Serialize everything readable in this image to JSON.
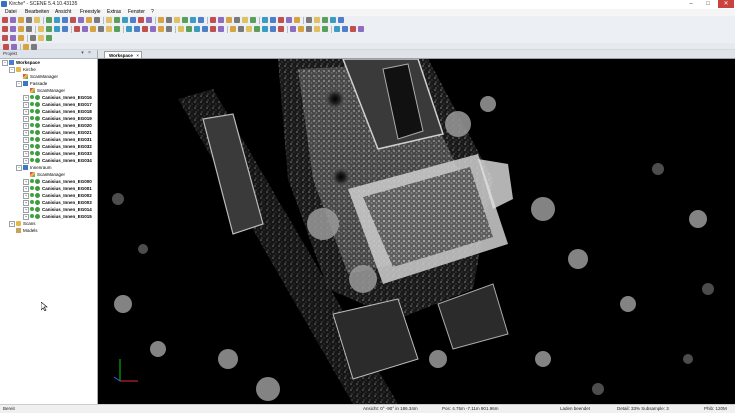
{
  "window": {
    "title": "Kirche* - SCENE 5.4.10.43135",
    "controls": [
      "–",
      "□",
      "✕"
    ]
  },
  "menu": [
    "Datei",
    "Bearbeiten",
    "Ansicht",
    "Freestyle",
    "Extras",
    "Fenster",
    "?"
  ],
  "panel": {
    "title": "Projekt",
    "tree": [
      {
        "label": "Workspace",
        "level": 0,
        "icon": "workspace-icon",
        "bold": true,
        "expander": "−"
      },
      {
        "label": "Kirche",
        "level": 1,
        "icon": "folder-icon",
        "bold": false,
        "expander": "−"
      },
      {
        "label": "ScanManager",
        "level": 2,
        "icon": "scanmanager-icon",
        "bold": false,
        "expander": ""
      },
      {
        "label": "Fassade",
        "level": 2,
        "icon": "scan-folder-icon",
        "bold": false,
        "expander": "−"
      },
      {
        "label": "ScanManager",
        "level": 3,
        "icon": "scanmanager-icon",
        "bold": false,
        "expander": ""
      },
      {
        "label": "Canisius_Innen_EG016",
        "level": 3,
        "icon": "scan-icon",
        "bold": true,
        "expander": "+"
      },
      {
        "label": "Canisius_Innen_EG017",
        "level": 3,
        "icon": "scan-icon",
        "bold": true,
        "expander": "+"
      },
      {
        "label": "Canisius_Innen_EG018",
        "level": 3,
        "icon": "scan-icon",
        "bold": true,
        "expander": "+"
      },
      {
        "label": "Canisius_Innen_EG019",
        "level": 3,
        "icon": "scan-icon",
        "bold": true,
        "expander": "+"
      },
      {
        "label": "Canisius_Innen_EG020",
        "level": 3,
        "icon": "scan-icon",
        "bold": true,
        "expander": "+"
      },
      {
        "label": "Canisius_Innen_EG021",
        "level": 3,
        "icon": "scan-icon",
        "bold": true,
        "expander": "+"
      },
      {
        "label": "Canisius_Innen_EG031",
        "level": 3,
        "icon": "scan-icon",
        "bold": true,
        "expander": "+"
      },
      {
        "label": "Canisius_Innen_EG032",
        "level": 3,
        "icon": "scan-icon",
        "bold": true,
        "expander": "+"
      },
      {
        "label": "Canisius_Innen_EG033",
        "level": 3,
        "icon": "scan-icon",
        "bold": true,
        "expander": "+"
      },
      {
        "label": "Canisius_Innen_EG034",
        "level": 3,
        "icon": "scan-icon",
        "bold": true,
        "expander": "+"
      },
      {
        "label": "Innenraum",
        "level": 2,
        "icon": "scan-folder-icon",
        "bold": false,
        "expander": "−"
      },
      {
        "label": "ScanManager",
        "level": 3,
        "icon": "scanmanager-icon",
        "bold": false,
        "expander": ""
      },
      {
        "label": "Canisius_Innen_EG000",
        "level": 3,
        "icon": "scan-icon",
        "bold": true,
        "expander": "+"
      },
      {
        "label": "Canisius_Innen_EG001",
        "level": 3,
        "icon": "scan-icon",
        "bold": true,
        "expander": "+"
      },
      {
        "label": "Canisius_Innen_EG002",
        "level": 3,
        "icon": "scan-icon",
        "bold": true,
        "expander": "+"
      },
      {
        "label": "Canisius_Innen_EG003",
        "level": 3,
        "icon": "scan-icon",
        "bold": true,
        "expander": "+"
      },
      {
        "label": "Canisius_Innen_EG014",
        "level": 3,
        "icon": "scan-icon",
        "bold": true,
        "expander": "+"
      },
      {
        "label": "Canisius_Innen_EG015",
        "level": 3,
        "icon": "scan-icon",
        "bold": true,
        "expander": "+"
      },
      {
        "label": "Scans",
        "level": 1,
        "icon": "folder-icon",
        "bold": false,
        "expander": "+"
      },
      {
        "label": "Models",
        "level": 1,
        "icon": "model-icon",
        "bold": false,
        "expander": ""
      }
    ]
  },
  "tabs": [
    {
      "label": "Workspace",
      "close": "×"
    }
  ],
  "status": {
    "left": "Bereit",
    "view": "Ansicht: 0° -90° in 186.34m",
    "pos": "Pos: 4.75m -7.11m 901.96m",
    "load": "Laden beendet",
    "detail": "Detail: 33%  Subsample: 3",
    "mem": "Phib: 120M"
  }
}
